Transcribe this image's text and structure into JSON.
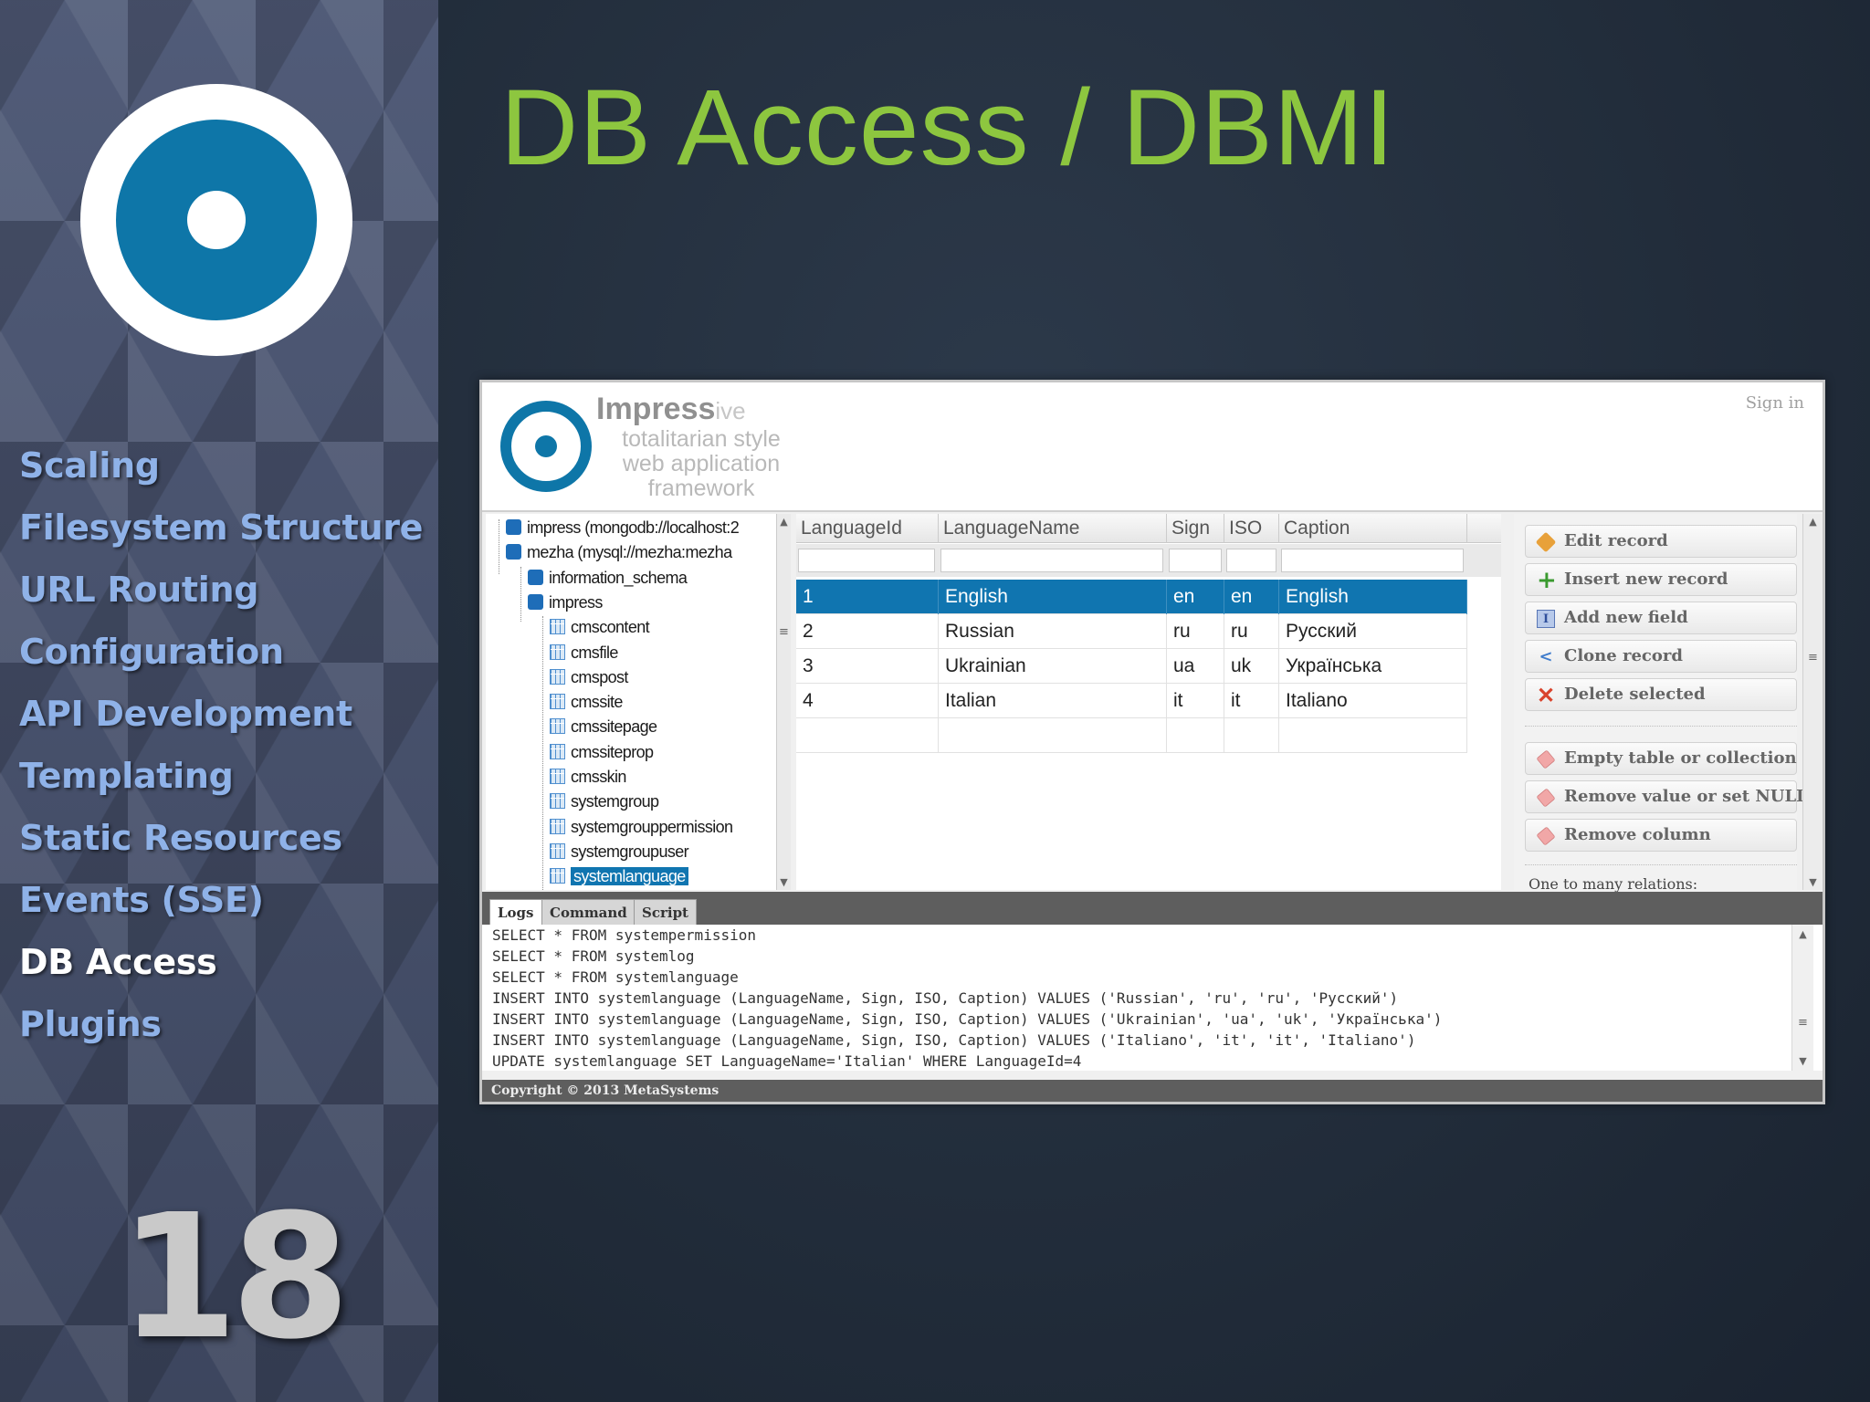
{
  "slide": {
    "title": "DB Access / DBMI",
    "number": "18",
    "nav": [
      {
        "label": "Scaling"
      },
      {
        "label": "Filesystem Structure"
      },
      {
        "label": "URL Routing"
      },
      {
        "label": "Configuration"
      },
      {
        "label": "API Development"
      },
      {
        "label": "Templating"
      },
      {
        "label": "Static Resources"
      },
      {
        "label": "Events (SSE)"
      },
      {
        "label": "DB Access"
      },
      {
        "label": "Plugins"
      }
    ],
    "active_nav": "DB Access"
  },
  "app": {
    "brand": {
      "name": "Impress",
      "name_suffix": "ive",
      "tagline_1": "totalitarian style",
      "tagline_2": "web application",
      "tagline_3": "framework"
    },
    "sign_in": "Sign in",
    "tree": {
      "items": [
        {
          "label": "impress (mongodb://localhost:2",
          "type": "db",
          "level": 0
        },
        {
          "label": "mezha (mysql://mezha:mezha",
          "type": "db",
          "level": 0
        },
        {
          "label": "information_schema",
          "type": "db",
          "level": 1
        },
        {
          "label": "impress",
          "type": "db",
          "level": 1
        },
        {
          "label": "cmscontent",
          "type": "table",
          "level": 2
        },
        {
          "label": "cmsfile",
          "type": "table",
          "level": 2
        },
        {
          "label": "cmspost",
          "type": "table",
          "level": 2
        },
        {
          "label": "cmssite",
          "type": "table",
          "level": 2
        },
        {
          "label": "cmssitepage",
          "type": "table",
          "level": 2
        },
        {
          "label": "cmssiteprop",
          "type": "table",
          "level": 2
        },
        {
          "label": "cmsskin",
          "type": "table",
          "level": 2
        },
        {
          "label": "systemgroup",
          "type": "table",
          "level": 2
        },
        {
          "label": "systemgrouppermission",
          "type": "table",
          "level": 2
        },
        {
          "label": "systemgroupuser",
          "type": "table",
          "level": 2
        },
        {
          "label": "systemlanguage",
          "type": "table",
          "level": 2,
          "selected": true
        }
      ]
    },
    "grid": {
      "columns": [
        "LanguageId",
        "LanguageName",
        "Sign",
        "ISO",
        "Caption"
      ],
      "rows": [
        [
          "1",
          "English",
          "en",
          "en",
          "English"
        ],
        [
          "2",
          "Russian",
          "ru",
          "ru",
          "Русский"
        ],
        [
          "3",
          "Ukrainian",
          "ua",
          "uk",
          "Українська"
        ],
        [
          "4",
          "Italian",
          "it",
          "it",
          "Italiano"
        ]
      ],
      "selected_row": 0
    },
    "actions": {
      "edit_record": "Edit record",
      "insert_new_record": "Insert new record",
      "add_new_field": "Add new field",
      "clone_record": "Clone record",
      "delete_selected": "Delete selected",
      "empty_table": "Empty table or collection",
      "remove_value": "Remove value or set NULL",
      "remove_column": "Remove column",
      "relations_label": "One to many relations:"
    },
    "console": {
      "tabs": [
        "Logs",
        "Command",
        "Script"
      ],
      "active_tab": "Logs",
      "lines": [
        "SELECT * FROM systempermission",
        "SELECT * FROM systemlog",
        "SELECT * FROM systemlanguage",
        "INSERT INTO systemlanguage (LanguageName, Sign, ISO, Caption) VALUES ('Russian', 'ru', 'ru', 'Русский')",
        "INSERT INTO systemlanguage (LanguageName, Sign, ISO, Caption) VALUES ('Ukrainian', 'ua', 'uk', 'Українська')",
        "INSERT INTO systemlanguage (LanguageName, Sign, ISO, Caption) VALUES ('Italiano', 'it', 'it', 'Italiano')",
        "UPDATE systemlanguage SET LanguageName='Italian' WHERE LanguageId=4"
      ]
    },
    "footer": "Copyright © 2013 MetaSystems"
  },
  "colors": {
    "title_green": "#8dc63f",
    "nav_blue": "#8fb2e8",
    "brand_blue": "#0e76a8",
    "selection_blue": "#1075b0"
  }
}
